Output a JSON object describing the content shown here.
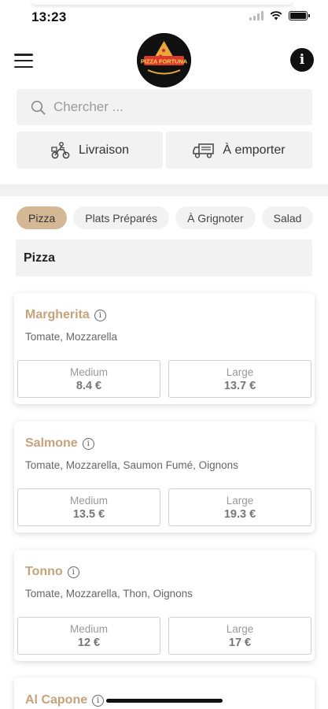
{
  "status_bar": {
    "time": "13:23"
  },
  "header": {
    "logo_text": "PIZZA FORTUNA",
    "info_label": "i"
  },
  "search": {
    "placeholder": "Chercher ..."
  },
  "modes": [
    {
      "label": "Livraison",
      "icon": "delivery-scooter-icon"
    },
    {
      "label": "À emporter",
      "icon": "takeaway-truck-icon"
    }
  ],
  "categories": [
    {
      "label": "Pizza",
      "active": true
    },
    {
      "label": "Plats Préparés",
      "active": false
    },
    {
      "label": "À Grignoter",
      "active": false
    },
    {
      "label": "Salad",
      "active": false
    }
  ],
  "section": {
    "title": "Pizza"
  },
  "products": [
    {
      "name": "Margherita",
      "description": "Tomate, Mozzarella",
      "prices": [
        {
          "size": "Medium",
          "value": "8.4 €"
        },
        {
          "size": "Large",
          "value": "13.7 €"
        }
      ]
    },
    {
      "name": "Salmone",
      "description": "Tomate, Mozzarella, Saumon Fumé, Oignons",
      "prices": [
        {
          "size": "Medium",
          "value": "13.5 €"
        },
        {
          "size": "Large",
          "value": "19.3 €"
        }
      ]
    },
    {
      "name": "Tonno",
      "description": "Tomate, Mozzarella, Thon, Oignons",
      "prices": [
        {
          "size": "Medium",
          "value": "12 €"
        },
        {
          "size": "Large",
          "value": "17 €"
        }
      ]
    },
    {
      "name": "Al Capone",
      "description": "",
      "prices": []
    }
  ],
  "colors": {
    "accent": "#c6a27c",
    "chip_active": "#d4b896",
    "panel": "#f2f2f2"
  }
}
